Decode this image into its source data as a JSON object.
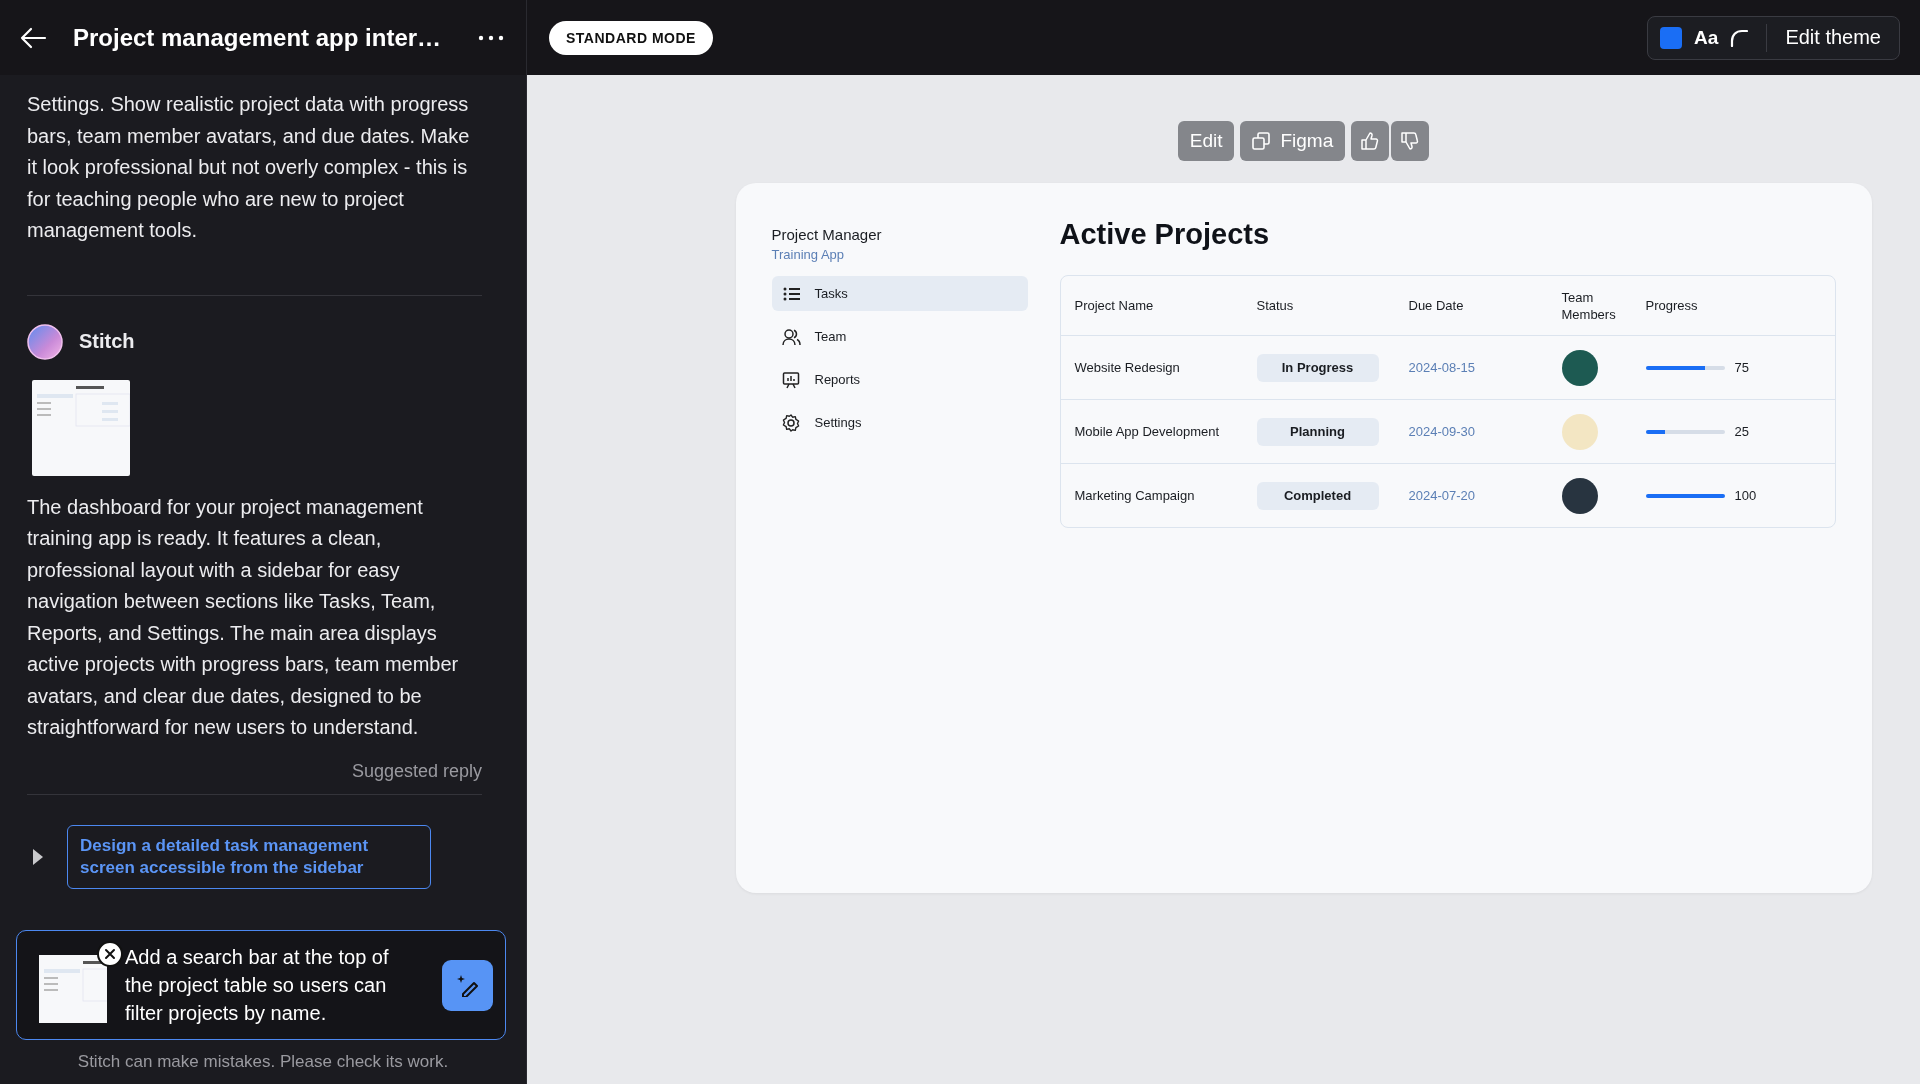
{
  "chat": {
    "title": "Project management app inter…",
    "prompt_text": "Settings. Show realistic project data with progress bars, team member avatars, and due dates. Make it look professional but not overly complex - this is for teaching people who are new to project management tools.",
    "author": "Stitch",
    "reply_text": "The dashboard for your project management training app is ready. It features a clean, professional layout with a sidebar for easy navigation between sections like Tasks, Team, Reports, and Settings. The main area displays active projects with progress bars, team member avatars, and clear due dates, designed to be straightforward for new users to understand.",
    "suggested_label": "Suggested reply",
    "suggestion": "Design a detailed task management screen accessible from the sidebar",
    "input_value": "Add a search bar at the top of the project table so users can filter projects by name.",
    "disclaimer": "Stitch can make mistakes. Please check its work."
  },
  "topbar": {
    "mode": "STANDARD MODE",
    "font_button": "Aa",
    "edit_theme": "Edit theme"
  },
  "toolbar": {
    "edit": "Edit",
    "figma": "Figma"
  },
  "app": {
    "brand": "Project Manager",
    "subtitle": "Training App",
    "nav": [
      {
        "label": "Tasks",
        "kind": "list",
        "selected": true
      },
      {
        "label": "Team",
        "kind": "team",
        "selected": false
      },
      {
        "label": "Reports",
        "kind": "report",
        "selected": false
      },
      {
        "label": "Settings",
        "kind": "gear",
        "selected": false
      }
    ],
    "heading": "Active Projects",
    "table": {
      "columns": [
        "Project Name",
        "Status",
        "Due Date",
        "Team Members",
        "Progress"
      ],
      "rows": [
        {
          "name": "Website Redesign",
          "status": "In Progress",
          "due": "2024-08-15",
          "color": "#1d5a52",
          "level": 0.75,
          "progress": "75"
        },
        {
          "name": "Mobile App Development",
          "status": "Planning",
          "due": "2024-09-30",
          "color": "#f3e6c3",
          "level": 0.25,
          "progress": "25"
        },
        {
          "name": "Marketing Campaign",
          "status": "Completed",
          "due": "2024-07-20",
          "color": "#283440",
          "level": 1,
          "progress": "100"
        }
      ]
    }
  }
}
